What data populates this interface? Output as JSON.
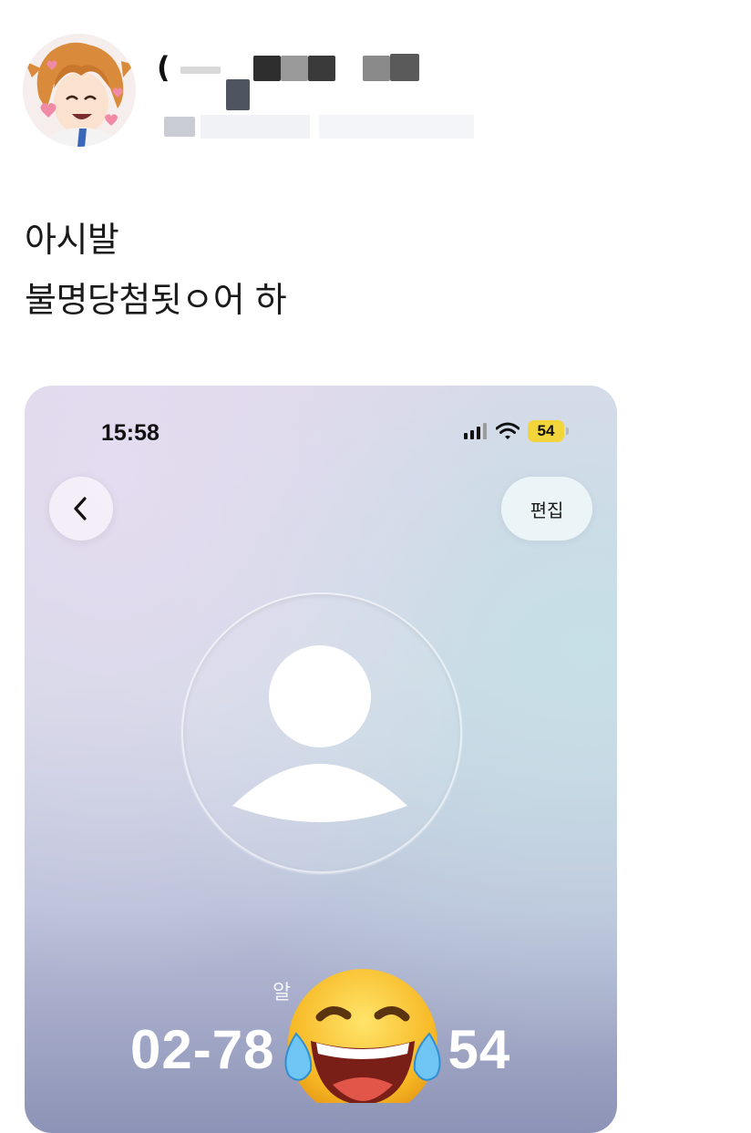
{
  "post": {
    "author_name_prefix": "(",
    "lines": [
      "아시발",
      "불명당첨됫ㅇ어 하"
    ]
  },
  "screenshot": {
    "status_time": "15:58",
    "battery": "54",
    "edit_label": "편집",
    "caption": "알",
    "number_left": "02-78",
    "number_right": "54",
    "emoji_name": "face-with-tears-of-joy"
  }
}
